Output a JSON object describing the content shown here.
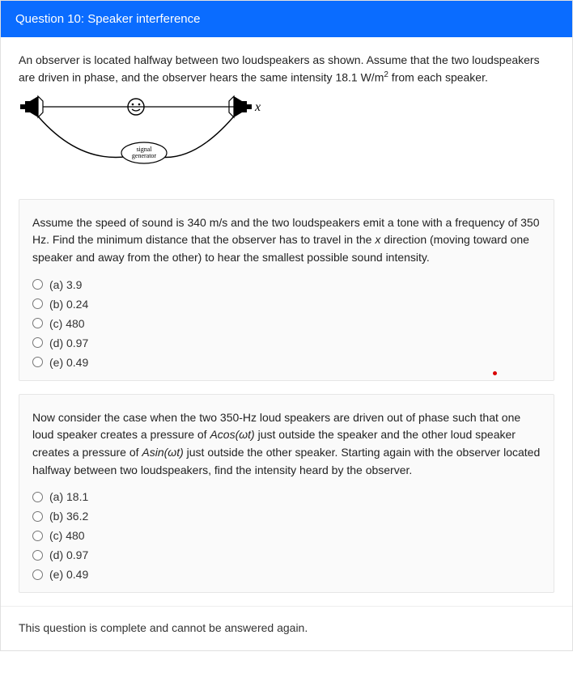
{
  "header": {
    "title": "Question 10: Speaker interference"
  },
  "intro": {
    "text_before": "An observer is located halfway between two loudspeakers as shown. Assume that the two loudspeakers are driven in phase, and the observer hears the same intensity 18.1 W/m",
    "sup": "2",
    "text_after": " from each speaker."
  },
  "diagram": {
    "x_label": "x",
    "signal_label_1": "signal",
    "signal_label_2": "generator"
  },
  "part1": {
    "prompt_before": "Assume the speed of sound is 340 m/s and the two loudspeakers emit a tone with a frequency of 350 Hz. Find the minimum distance that the observer has to travel in the ",
    "prompt_var": "x",
    "prompt_after": " direction (moving toward one speaker and away from the other) to hear the smallest possible sound intensity.",
    "options": [
      {
        "label": "(a) 3.9"
      },
      {
        "label": "(b) 0.24"
      },
      {
        "label": "(c) 480"
      },
      {
        "label": "(d) 0.97"
      },
      {
        "label": "(e) 0.49"
      }
    ]
  },
  "part2": {
    "prompt_before": "Now consider the case when the two 350-Hz loud speakers are driven out of phase such that one loud speaker creates a pressure of ",
    "eq1": "Acos(ωt)",
    "prompt_mid": " just outside the speaker and the other loud speaker creates a pressure of ",
    "eq2": "Asin(ωt)",
    "prompt_after": " just outside the other speaker. Starting again with the observer located halfway between two loudspeakers, find the intensity heard by the observer.",
    "options": [
      {
        "label": "(a) 18.1"
      },
      {
        "label": "(b) 36.2"
      },
      {
        "label": "(c) 480"
      },
      {
        "label": "(d) 0.97"
      },
      {
        "label": "(e) 0.49"
      }
    ]
  },
  "footer": {
    "message": "This question is complete and cannot be answered again."
  }
}
